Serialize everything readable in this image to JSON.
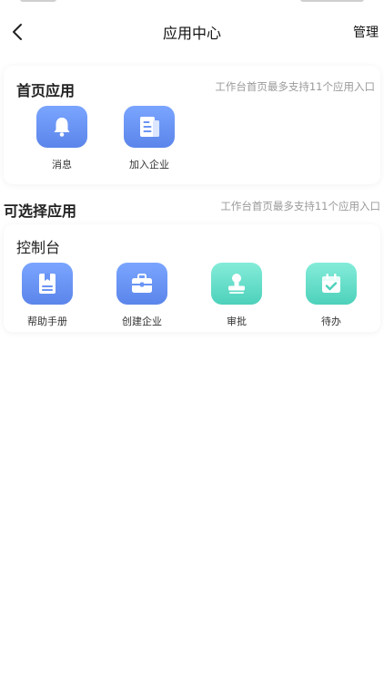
{
  "header": {
    "title": "应用中心",
    "manage_label": "管理"
  },
  "home_apps": {
    "title": "首页应用",
    "hint": "工作台首页最多支持11个应用入口",
    "items": [
      {
        "label": "消息",
        "icon": "bell-icon"
      },
      {
        "label": "加入企业",
        "icon": "document-icon"
      }
    ]
  },
  "optional_apps": {
    "title": "可选择应用",
    "hint": "工作台首页最多支持11个应用入口",
    "group": {
      "title": "控制台",
      "items": [
        {
          "label": "帮助手册",
          "icon": "bookmark-book-icon"
        },
        {
          "label": "创建企业",
          "icon": "briefcase-icon"
        },
        {
          "label": "审批",
          "icon": "stamp-icon"
        },
        {
          "label": "待办",
          "icon": "calendar-check-icon"
        }
      ]
    }
  },
  "colors": {
    "blue_icon": "#6a94f5",
    "teal_icon": "#5ed9c3",
    "hint_text": "#9a9a9a"
  }
}
